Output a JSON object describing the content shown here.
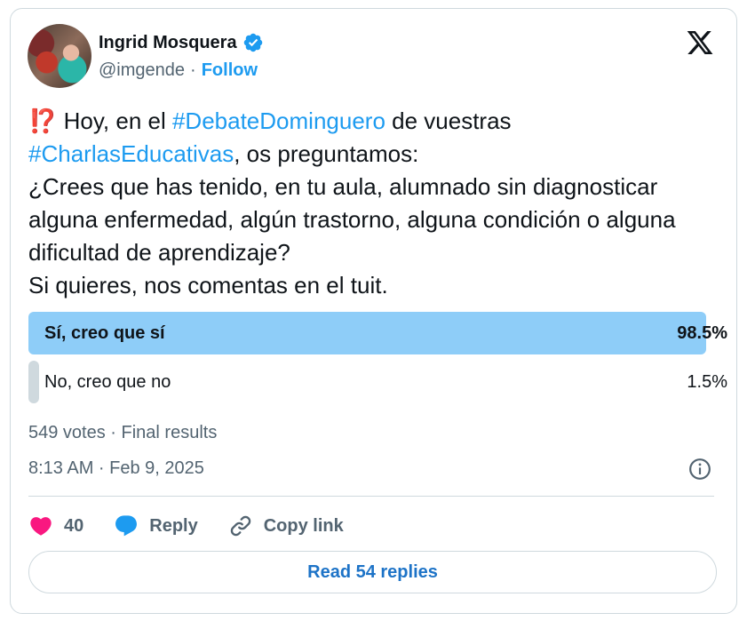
{
  "author": {
    "name": "Ingrid Mosquera",
    "handle": "@imgende",
    "separator": "·",
    "follow_label": "Follow"
  },
  "tweet": {
    "emoji": "⁉️",
    "parts": {
      "p1": " Hoy, en el ",
      "tag1": "#DebateDominguero",
      "p2": " de vuestras ",
      "tag2": "#CharlasEducativas",
      "p3": ", os preguntamos:",
      "line2": "¿Crees que has tenido, en tu aula, alumnado sin diagnosticar alguna enfermedad, algún trastorno, alguna condición o alguna dificultad de aprendizaje?",
      "line3": "Si quieres, nos comentas en el tuit."
    }
  },
  "poll": {
    "options": [
      {
        "label": "Sí, creo que sí",
        "percent_text": "98.5%",
        "fraction": 0.985,
        "winner": true
      },
      {
        "label": "No, creo que no",
        "percent_text": "1.5%",
        "fraction": 0.015,
        "winner": false
      }
    ],
    "meta": "549 votes · Final results"
  },
  "timestamp": "8:13 AM · Feb 9, 2025",
  "actions": {
    "like_count": "40",
    "reply_label": "Reply",
    "copy_label": "Copy link"
  },
  "read_replies_label": "Read 54 replies",
  "icons": {
    "verified": "verified-badge-icon",
    "x_logo": "x-logo-icon",
    "info": "info-icon",
    "like": "heart-icon",
    "reply": "speech-bubble-icon",
    "copy": "link-icon"
  },
  "colors": {
    "accent": "#1d9bf0",
    "winner_bar": "#8ecdf8",
    "loser_bar": "#cfd9de",
    "heart": "#f91880",
    "muted": "#536471"
  }
}
